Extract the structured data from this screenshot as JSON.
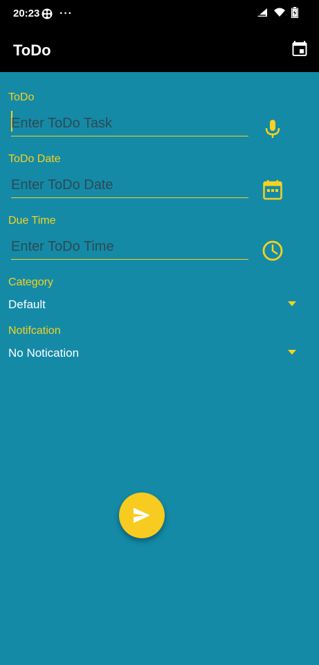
{
  "status": {
    "time": "20:23",
    "dots": "···"
  },
  "app": {
    "title": "ToDo"
  },
  "form": {
    "todo": {
      "label": "ToDo",
      "placeholder": "Enter ToDo Task",
      "value": ""
    },
    "date": {
      "label": "ToDo Date",
      "placeholder": "Enter ToDo Date",
      "value": ""
    },
    "time": {
      "label": "Due Time",
      "placeholder": "Enter ToDo Time",
      "value": ""
    },
    "category": {
      "label": "Category",
      "selected": "Default"
    },
    "notification": {
      "label": "Notifcation",
      "selected": "No Notication"
    }
  },
  "colors": {
    "background": "#148aa7",
    "accent": "#f7d21e",
    "bar": "#000000"
  },
  "icons": {
    "appbar_action": "calendar-today-icon",
    "todo_action": "microphone-icon",
    "date_action": "calendar-icon",
    "time_action": "clock-icon",
    "fab": "send-icon"
  }
}
